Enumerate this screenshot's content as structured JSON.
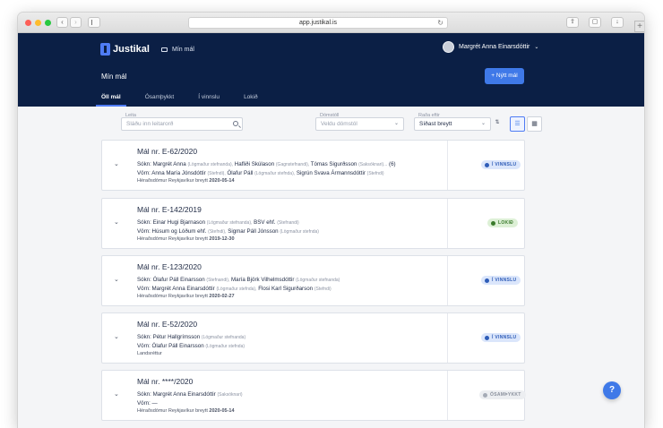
{
  "browser": {
    "url": "app.justikal.is",
    "new_tab_label": "+"
  },
  "header": {
    "logo_text": "Justikal",
    "nav_label": "Mín mál",
    "user_name": "Margrét Anna Einarsdóttir",
    "page_title": "Mín mál",
    "new_case_button": "+ Nýtt mál"
  },
  "tabs": [
    {
      "label": "Öll mál",
      "active": true
    },
    {
      "label": "Ósamþykkt",
      "active": false
    },
    {
      "label": "Í vinnslu",
      "active": false
    },
    {
      "label": "Lokið",
      "active": false
    }
  ],
  "filters": {
    "search_label": "Leita",
    "search_placeholder": "Sláðu inn leitarorð",
    "court_label": "Dómstóll",
    "court_value": "Veldu dómstól",
    "sort_label": "Raða eftir",
    "sort_value": "Síðast breytt"
  },
  "cases": [
    {
      "title": "Mál nr. E-62/2020",
      "prosecution_label": "Sókn:",
      "prosecution": [
        {
          "name": "Margrét Anna",
          "role": "(Lögmaður stefnanda),"
        },
        {
          "name": "Hafliði Skúlason",
          "role": "(Gagnstefnandi),"
        },
        {
          "name": "Tómas Sigurðsson",
          "role": "(Saksóknari)..."
        }
      ],
      "prosecution_extra": "(6)",
      "defense_label": "Vörn:",
      "defense": [
        {
          "name": "Anna María Jónsdóttir",
          "role": "(Stefndi),"
        },
        {
          "name": "Ólafur Páll",
          "role": "(Lögmaður stefnda),"
        },
        {
          "name": "Sigrún Svava Ármannsdóttir",
          "role": "(Stefndi)"
        }
      ],
      "court": "Héraðsdómur Reykjavíkur",
      "changed_prefix": "breytt",
      "changed": "2020-05-14",
      "status": "Í VINNSLU",
      "status_kind": "inprog"
    },
    {
      "title": "Mál nr. E-142/2019",
      "prosecution_label": "Sókn:",
      "prosecution": [
        {
          "name": "Einar Hugi Bjarnason",
          "role": "(Lögmaður stefnanda),"
        },
        {
          "name": "BSV ehf.",
          "role": "(Stefnandi)"
        }
      ],
      "prosecution_extra": "",
      "defense_label": "Vörn:",
      "defense": [
        {
          "name": "Húsum og Lóðum ehf.",
          "role": "(Stefndi),"
        },
        {
          "name": "Sigmar Páll Jónsson",
          "role": "(Lögmaður stefnda)"
        }
      ],
      "court": "Héraðsdómur Reykjavíkur",
      "changed_prefix": "breytt",
      "changed": "2019-12-30",
      "status": "LOKIÐ",
      "status_kind": "closed"
    },
    {
      "title": "Mál nr. E-123/2020",
      "prosecution_label": "Sókn:",
      "prosecution": [
        {
          "name": "Ólafur Páll Einarsson",
          "role": "(Stefnandi),"
        },
        {
          "name": "María Björk Vilhelmsdóttir",
          "role": "(Lögmaður stefnanda)"
        }
      ],
      "prosecution_extra": "",
      "defense_label": "Vörn:",
      "defense": [
        {
          "name": "Margrét Anna Einarsdóttir",
          "role": "(Lögmaður stefnda),"
        },
        {
          "name": "Flosi Karl Sigurðarson",
          "role": "(Stefndi)"
        }
      ],
      "court": "Héraðsdómur Reykjavíkur",
      "changed_prefix": "breytt",
      "changed": "2020-02-27",
      "status": "Í VINNSLU",
      "status_kind": "inprog"
    },
    {
      "title": "Mál nr. E-52/2020",
      "prosecution_label": "Sókn:",
      "prosecution": [
        {
          "name": "Pétur Hallgrímsson",
          "role": "(Lögmaður stefnanda)"
        }
      ],
      "prosecution_extra": "",
      "defense_label": "Vörn:",
      "defense": [
        {
          "name": "Ólafur Páll Einarsson",
          "role": "(Lögmaður stefnda)"
        }
      ],
      "court": "Landsréttur",
      "changed_prefix": "",
      "changed": "",
      "status": "Í VINNSLU",
      "status_kind": "inprog"
    },
    {
      "title": "Mál nr. ****/2020",
      "prosecution_label": "Sókn:",
      "prosecution": [
        {
          "name": "Margrét Anna Einarsdóttir",
          "role": "(Saksóknari)"
        }
      ],
      "prosecution_extra": "",
      "defense_label": "Vörn:",
      "defense": [
        {
          "name": "—",
          "role": ""
        }
      ],
      "court": "Héraðsdómur Reykjavíkur",
      "changed_prefix": "breytt",
      "changed": "2020-05-14",
      "status": "ÓSAMÞYKKT",
      "status_kind": "unapproved"
    }
  ],
  "help_label": "?",
  "icons": {
    "expand": "chevron-down-icon",
    "sort": "sort-icon",
    "list_view": "list-view-icon",
    "grid_view": "grid-view-icon"
  }
}
